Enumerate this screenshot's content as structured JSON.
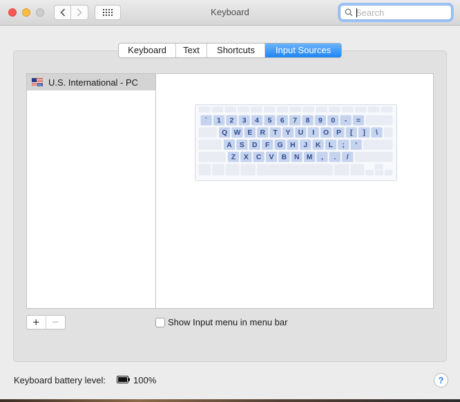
{
  "window": {
    "title": "Keyboard"
  },
  "toolbar": {
    "back_icon": "chevron-left-icon",
    "forward_icon": "chevron-right-icon",
    "show_all_icon": "grid-icon"
  },
  "search": {
    "placeholder": "Search",
    "value": ""
  },
  "tabs": [
    {
      "label": "Keyboard",
      "active": false
    },
    {
      "label": "Text",
      "active": false
    },
    {
      "label": "Shortcuts",
      "active": false
    },
    {
      "label": "Input Sources",
      "active": true
    }
  ],
  "input_sources": {
    "items": [
      {
        "label": "U.S. International - PC",
        "icon": "us-flag-icon",
        "selected": true
      }
    ],
    "add_label": "+",
    "remove_label": "−"
  },
  "keyboard_preview": {
    "rows": [
      [
        "`",
        "1",
        "2",
        "3",
        "4",
        "5",
        "6",
        "7",
        "8",
        "9",
        "0",
        "-",
        "="
      ],
      [
        "Q",
        "W",
        "E",
        "R",
        "T",
        "Y",
        "U",
        "I",
        "O",
        "P",
        "[",
        "]",
        "\\"
      ],
      [
        "A",
        "S",
        "D",
        "F",
        "G",
        "H",
        "J",
        "K",
        "L",
        ";",
        "'"
      ],
      [
        "Z",
        "X",
        "C",
        "V",
        "B",
        "N",
        "M",
        ",",
        ".",
        "/"
      ]
    ],
    "key_color": "#c5d3ee",
    "key_text_color": "#2f4c8f"
  },
  "options": {
    "show_input_menu": {
      "label": "Show Input menu in menu bar",
      "checked": false
    }
  },
  "footer": {
    "battery_label": "Keyboard battery level:",
    "battery_value": "100%",
    "battery_icon": "battery-full-icon",
    "help_label": "?"
  },
  "colors": {
    "accent": "#1f86f6",
    "close": "#fc5753",
    "minimize": "#fdbc40",
    "zoom_disabled": "#cdcdcd"
  }
}
